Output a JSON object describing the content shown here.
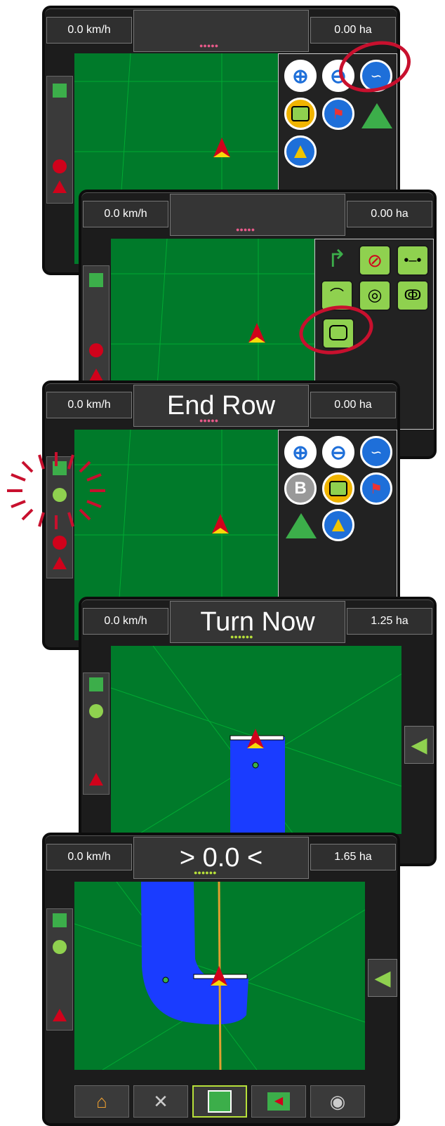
{
  "screens": [
    {
      "speed": "0.0 km/h",
      "area": "0.00 ha",
      "message": ""
    },
    {
      "speed": "0.0 km/h",
      "area": "0.00 ha",
      "message": ""
    },
    {
      "speed": "0.0 km/h",
      "area": "0.00 ha",
      "message": "End Row"
    },
    {
      "speed": "0.0 km/h",
      "area": "1.25 ha",
      "message": "Turn Now"
    },
    {
      "speed": "0.0 km/h",
      "area": "1.65 ha",
      "message": "> 0.0 <"
    }
  ],
  "guidance_icons": {
    "zoom_in": "zoom-in-icon",
    "zoom_out": "zoom-out-icon",
    "guidance_mode": "guidance-mode-icon",
    "boundary": "boundary-icon",
    "marker_add": "flag-add-icon",
    "vehicle_view": "vehicle-view-icon",
    "point_b": "B"
  },
  "guidance_modes": [
    "return-to-point-icon",
    "no-guidance-icon",
    "straight-ab-icon",
    "curved-ab-icon",
    "circle-pivot-icon",
    "adaptive-curve-icon",
    "last-pass-icon"
  ],
  "nav_bar": [
    "home-icon",
    "tools-icon",
    "guidance-screen-icon",
    "left-arrow-icon",
    "camera-icon"
  ],
  "colors": {
    "accent_red": "#c8102e",
    "field_green": "#007a2a",
    "coverage_blue": "#1a3cff",
    "button_green": "#8fd14f"
  }
}
